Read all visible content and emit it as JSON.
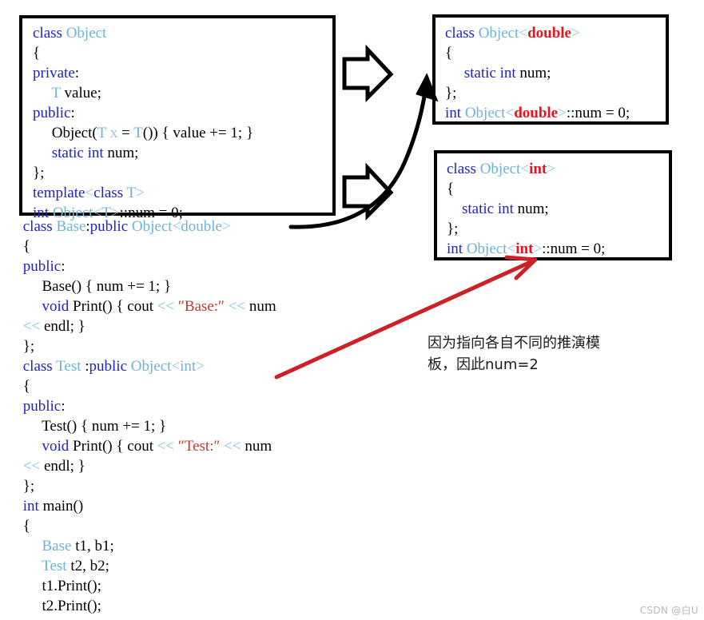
{
  "document": {
    "kind": "annotated-code-diagram",
    "topic": "C++ class template static member instantiation"
  },
  "left_code": {
    "template_header": "template<class T>",
    "boxed_lines": [
      "class Object",
      "{",
      "private:",
      "     T value;",
      "public:",
      "     Object(T x = T()) { value += 1; }",
      "     static int num;",
      "};",
      "template<class T>",
      "int Object<T>::num = 0;"
    ],
    "lower_lines": [
      "class Base:public Object<double>",
      "{",
      "public:",
      "     Base() { num += 1; }",
      "     void Print() { cout << \"Base:\" << num",
      "<< endl; }",
      "};",
      "class Test :public Object<int>",
      "{",
      "public:",
      "     Test() { num += 1; }",
      "     void Print() { cout << \"Test:\" << num",
      "<< endl; }",
      "};",
      "int main()",
      "{",
      "     Base t1, b1;",
      "     Test t2, b2;",
      "     t1.Print();",
      "     t2.Print();"
    ]
  },
  "inst_double": {
    "title": "class Object<double>",
    "lines": [
      "class Object<double>",
      "{",
      "     static int num;",
      "};",
      "int Object<double>::num = 0;"
    ],
    "specialization": "double"
  },
  "inst_int": {
    "title": "class Object<int>",
    "lines": [
      "class Object<int>",
      "{",
      "     static int num;",
      "};",
      "int Object<int>::num = 0;"
    ],
    "specialization": "int"
  },
  "annotation": {
    "text": "因为指向各自不同的推演模\n板，因此num=2"
  },
  "watermark": {
    "text": "CSDN @白U"
  },
  "colors": {
    "keyword": "#2222cc",
    "type": "#6db3da",
    "string": "#c0392b",
    "stream_op": "#7fc4e0",
    "specialization_red": "#e8131d",
    "arrow_black": "#000000",
    "arrow_red": "#cc2128",
    "border": "#000000",
    "background": "#ffffff"
  },
  "arrows": {
    "block_arrow_top": "hollow-right-arrow",
    "block_arrow_bottom": "hollow-right-arrow",
    "curved_arrow": "curved-black-arrow-to-double-box",
    "red_arrow": "red-arrow-to-int-box"
  }
}
